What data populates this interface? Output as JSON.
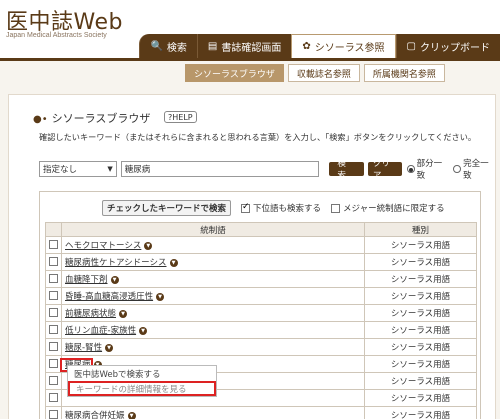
{
  "header": {
    "logo_title": "医中誌Web",
    "logo_subtitle": "Japan Medical Abstracts Society",
    "tabs": [
      {
        "icon": "🔍",
        "label": "検索"
      },
      {
        "icon": "▤",
        "label": "書誌確認画面"
      },
      {
        "icon": "✿",
        "label": "シソーラス参照"
      },
      {
        "icon": "▢",
        "label": "クリップボード"
      }
    ]
  },
  "subtabs": [
    "シソーラスブラウザ",
    "収載誌名参照",
    "所属機関名参照"
  ],
  "section": {
    "title": "シソーラスブラウザ",
    "help": "?HELP",
    "instruction": "確認したいキーワード（またはそれらに含まれると思われる言葉）を入力し、「検索」ボタンをクリックしてください。"
  },
  "search": {
    "select_value": "指定なし",
    "input_value": "糖尿病",
    "search_button": "検 索",
    "clear_button": "クリア",
    "radio_partial": "部分一致",
    "radio_exact": "完全一致"
  },
  "results": {
    "checked_button": "チェックしたキーワードで検索",
    "lower_label": "下位語も検索する",
    "major_label": "メジャー統制語に限定する",
    "col_term": "統制語",
    "col_type": "種別",
    "rows": [
      {
        "term": "ヘモクロマトーシス",
        "type": "シソーラス用語"
      },
      {
        "term": "糖尿病性ケトアシドーシス",
        "type": "シソーラス用語"
      },
      {
        "term": "血糖降下剤",
        "type": "シソーラス用語"
      },
      {
        "term": "昏睡-高血糖高浸透圧性",
        "type": "シソーラス用語"
      },
      {
        "term": "前糖尿病状態",
        "type": "シソーラス用語"
      },
      {
        "term": "低リン血症-家族性",
        "type": "シソーラス用語"
      },
      {
        "term": "糖尿-腎性",
        "type": "シソーラス用語"
      },
      {
        "term": "糖尿病",
        "type": "シソーラス用語"
      },
      {
        "term": "",
        "type": "シソーラス用語"
      },
      {
        "term": "",
        "type": "シソーラス用語"
      },
      {
        "term": "糖尿病合併妊娠",
        "type": "シソーラス用語"
      }
    ]
  },
  "popup": {
    "item1": "医中誌Webで検索する",
    "item2": "キーワードの詳細情報を見る"
  }
}
